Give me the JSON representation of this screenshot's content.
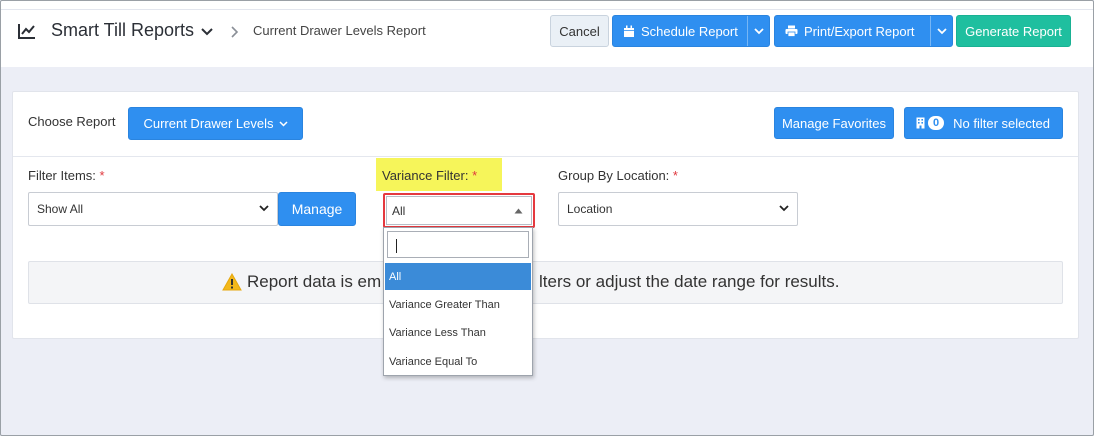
{
  "header": {
    "app_title": "Smart Till Reports",
    "breadcrumb": "Current Drawer Levels Report",
    "icons": {
      "app": "line-chart-icon",
      "title_dropdown": "chevron-down-icon",
      "separator": "chevron-right-icon"
    }
  },
  "toolbar": {
    "cancel_label": "Cancel",
    "schedule_label": "Schedule Report",
    "print_label": "Print/Export Report",
    "generate_label": "Generate Report",
    "colors": {
      "primary": "#2f8ff0",
      "success": "#1fbf9f"
    }
  },
  "report_bar": {
    "choose_label": "Choose Report",
    "report_button_label": "Current Drawer Levels",
    "favorites_label": "Manage Favorites",
    "filter_count": "0",
    "filter_status": "No filter selected"
  },
  "filters": {
    "required_mark": "*",
    "filter_items": {
      "label": "Filter Items:",
      "value": "Show All",
      "manage_label": "Manage"
    },
    "variance": {
      "label": "Variance Filter:",
      "value": "All",
      "options": [
        "All",
        "Variance Greater Than",
        "Variance Less Than",
        "Variance Equal To"
      ],
      "selected_index": 0,
      "highlight_color": "#f6f55a",
      "outline_color": "#e5393f"
    },
    "group_by": {
      "label": "Group By Location:",
      "value": "Location"
    }
  },
  "alert": {
    "text_before": "Report data is em",
    "text_after": "lters or adjust the date range for results.",
    "icon": "warning-icon"
  }
}
